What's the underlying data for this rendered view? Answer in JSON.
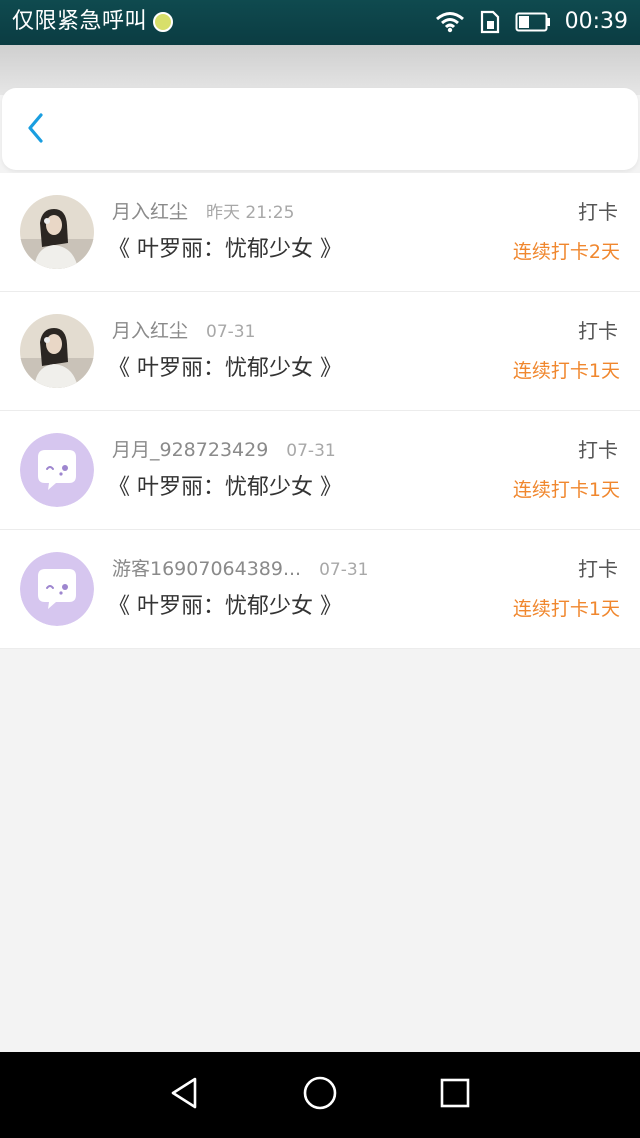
{
  "status_bar": {
    "carrier": "仅限紧急呼叫",
    "time": "00:39",
    "icons": [
      "sim-icon",
      "wifi-icon",
      "sim-card-icon",
      "battery-icon"
    ]
  },
  "header": {
    "back_icon": "chevron-left-icon",
    "accent": "#1a9ee0"
  },
  "entries": [
    {
      "name": "月入红尘",
      "time": "昨天 21:25",
      "title": "《 叶罗丽：忧郁少女 》",
      "action": "打卡",
      "streak": "连续打卡2天",
      "avatar": "photo"
    },
    {
      "name": "月入红尘",
      "time": "07-31",
      "title": "《 叶罗丽：忧郁少女 》",
      "action": "打卡",
      "streak": "连续打卡1天",
      "avatar": "photo"
    },
    {
      "name": "月月_928723429",
      "time": "07-31",
      "title": "《 叶罗丽：忧郁少女 》",
      "action": "打卡",
      "streak": "连续打卡1天",
      "avatar": "default"
    },
    {
      "name": "游客16907064389...",
      "time": "07-31",
      "title": "《 叶罗丽：忧郁少女 》",
      "action": "打卡",
      "streak": "连续打卡1天",
      "avatar": "default"
    }
  ],
  "colors": {
    "streak": "#f0872e",
    "default_avatar": "#d6c6ef",
    "status_bar": "#0d4147"
  },
  "nav": {
    "icons": [
      "back-triangle-icon",
      "home-circle-icon",
      "recents-square-icon"
    ]
  }
}
